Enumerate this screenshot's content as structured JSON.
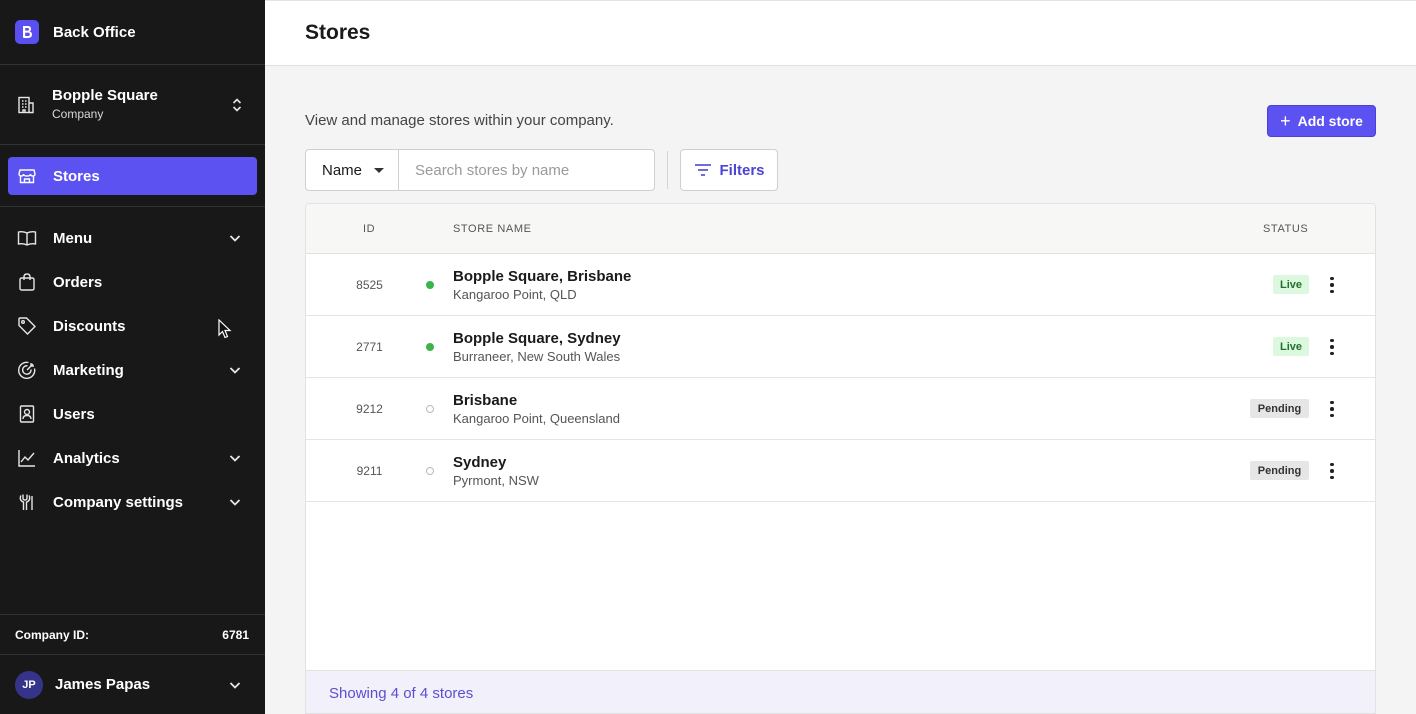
{
  "brand": {
    "title": "Back Office",
    "accent": "#5c52f2"
  },
  "company": {
    "name": "Bopple Square",
    "subtitle": "Company"
  },
  "nav": {
    "active": {
      "label": "Stores",
      "icon": "store-icon"
    },
    "items": [
      {
        "label": "Menu",
        "icon": "book-icon",
        "expandable": true
      },
      {
        "label": "Orders",
        "icon": "bag-icon",
        "expandable": false
      },
      {
        "label": "Discounts",
        "icon": "tag-icon",
        "expandable": false
      },
      {
        "label": "Marketing",
        "icon": "target-icon",
        "expandable": true
      },
      {
        "label": "Users",
        "icon": "user-badge-icon",
        "expandable": false
      },
      {
        "label": "Analytics",
        "icon": "chart-line-icon",
        "expandable": true
      },
      {
        "label": "Company settings",
        "icon": "wrench-icon",
        "expandable": true
      }
    ]
  },
  "footer": {
    "company_id_label": "Company ID:",
    "company_id_value": "6781"
  },
  "user": {
    "initials": "JP",
    "name": "James Papas"
  },
  "header": {
    "title": "Stores"
  },
  "main": {
    "description": "View and manage stores within your company.",
    "add_button": "Add store",
    "search": {
      "field": "Name",
      "placeholder": "Search stores by name"
    },
    "filters_button": "Filters"
  },
  "table": {
    "columns": {
      "id": "ID",
      "name": "STORE NAME",
      "status": "STATUS"
    },
    "rows": [
      {
        "id": "8525",
        "name": "Bopple Square, Brisbane",
        "location": "Kangaroo Point, QLD",
        "status": "Live",
        "live": true
      },
      {
        "id": "2771",
        "name": "Bopple Square, Sydney",
        "location": "Burraneer, New South Wales",
        "status": "Live",
        "live": true
      },
      {
        "id": "9212",
        "name": "Brisbane",
        "location": "Kangaroo Point, Queensland",
        "status": "Pending",
        "live": false
      },
      {
        "id": "9211",
        "name": "Sydney",
        "location": "Pyrmont, NSW",
        "status": "Pending",
        "live": false
      }
    ],
    "footer_text": "Showing 4 of 4 stores"
  },
  "colors": {
    "live": "#3bb54a",
    "live_badge_bg": "#dcf8df",
    "pending_badge_bg": "#e6e6e6",
    "sidebar_bg": "#181818"
  }
}
